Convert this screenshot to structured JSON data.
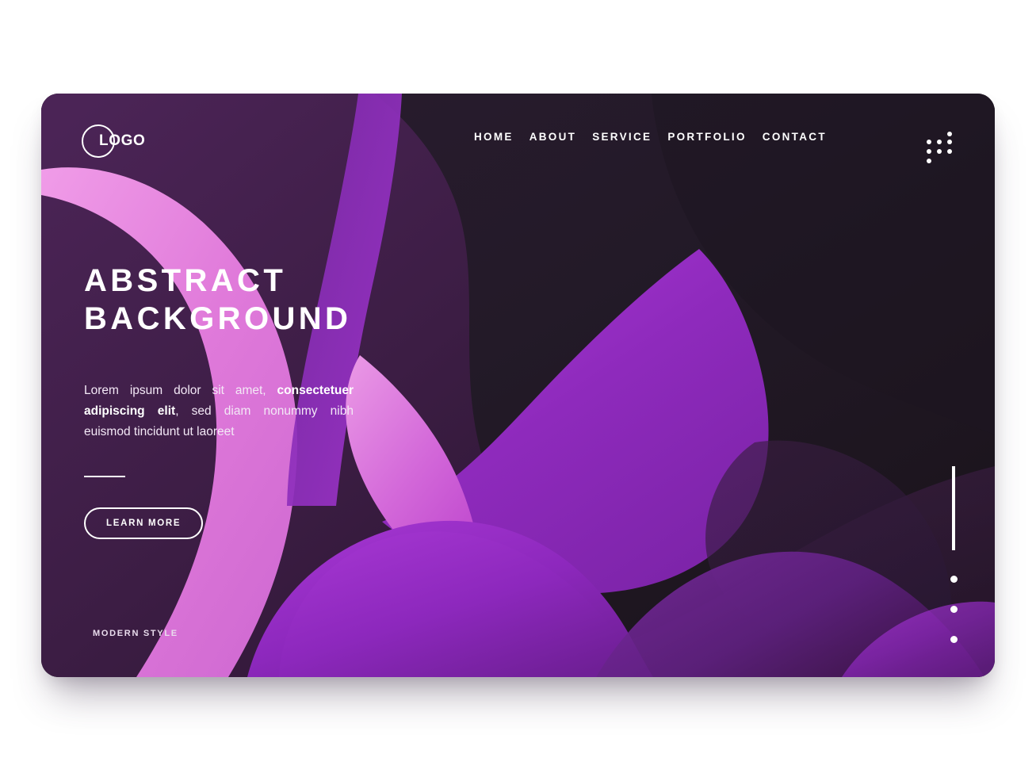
{
  "page": {
    "background_color": "#ffffff",
    "card_background": "#1f1822",
    "accent_purple": "#9b2fcc",
    "accent_pink": "#e88ede",
    "deep_plum": "#3d1f46"
  },
  "header": {
    "logo": {
      "text": "LOGO",
      "ring_icon": "circle-outline-icon"
    },
    "nav_items": [
      {
        "label": "HOME"
      },
      {
        "label": "ABOUT"
      },
      {
        "label": "SERVICE"
      },
      {
        "label": "PORTFOLIO"
      },
      {
        "label": "CONTACT"
      }
    ],
    "menu_icon": "apps-grid-dots-icon"
  },
  "hero": {
    "title_line_1": "ABSTRACT",
    "title_line_2": "BACKGROUND",
    "paragraph": {
      "part_1": "Lorem ipsum dolor sit amet, ",
      "bold_part": "consectetuer adipiscing elit",
      "part_2": ", sed diam nonummy nibh euismod tincidunt ut laoreet"
    },
    "cta_label": "LEARN MORE"
  },
  "footer": {
    "tagline": "MODERN STYLE"
  },
  "slider": {
    "active_indicator": "vertical-bar",
    "dots": [
      {
        "id": "dot-1"
      },
      {
        "id": "dot-2"
      },
      {
        "id": "dot-3"
      }
    ]
  }
}
